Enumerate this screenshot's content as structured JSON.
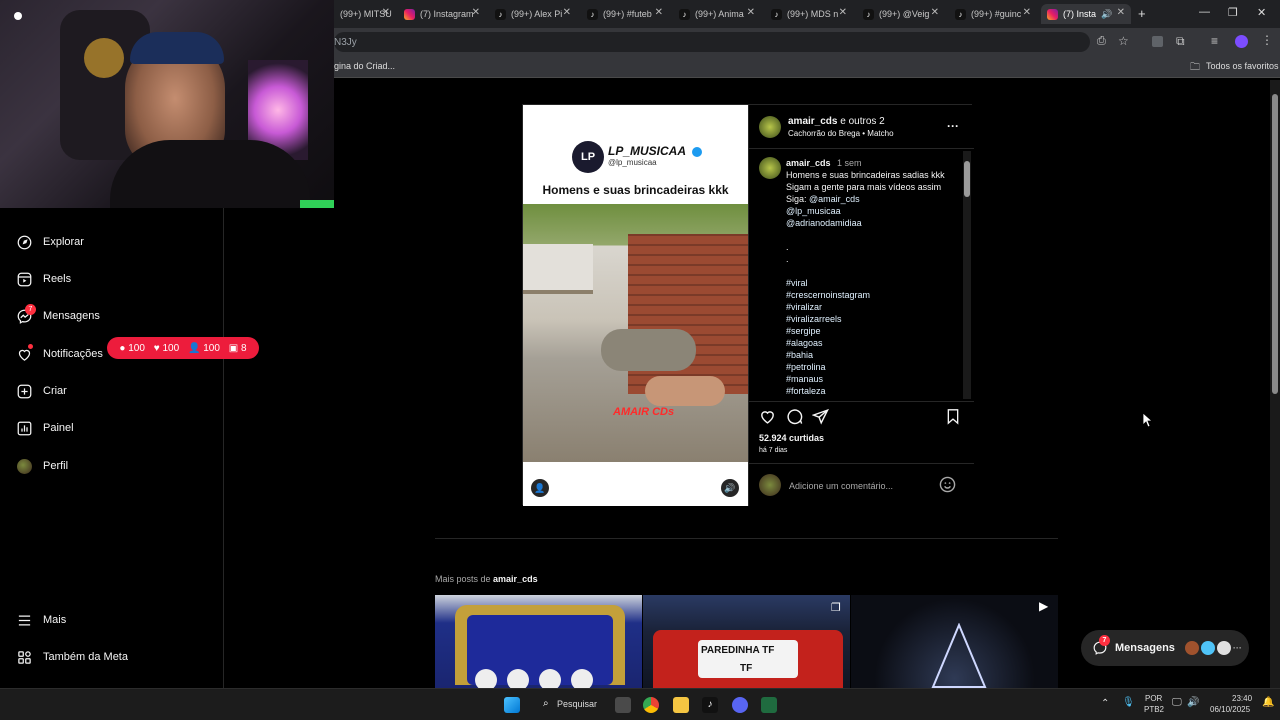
{
  "browser": {
    "tabs": [
      {
        "label": "(99+) MITSU"
      },
      {
        "label": "(7) Instagram"
      },
      {
        "label": "(99+) Alex Pi"
      },
      {
        "label": "(99+) #futeb"
      },
      {
        "label": "(99+) Anima"
      },
      {
        "label": "(99+) MDS n"
      },
      {
        "label": "(99+) @Veig"
      },
      {
        "label": "(99+) #guinc"
      },
      {
        "label": "(7) Insta"
      }
    ],
    "url_fragment": "N3Jy",
    "bookmark_item": "gina do Criad...",
    "all_bookmarks": "Todos os favoritos"
  },
  "sidebar": {
    "items": [
      {
        "label": "Explorar",
        "icon": "compass-icon"
      },
      {
        "label": "Reels",
        "icon": "reels-icon"
      },
      {
        "label": "Mensagens",
        "icon": "messenger-icon",
        "badge": "7"
      },
      {
        "label": "Notificações",
        "icon": "heart-icon"
      },
      {
        "label": "Criar",
        "icon": "plus-square-icon"
      },
      {
        "label": "Painel",
        "icon": "bar-chart-icon"
      },
      {
        "label": "Perfil",
        "icon": "avatar-icon"
      },
      {
        "label": "Mais",
        "icon": "menu-icon"
      },
      {
        "label": "Também da Meta",
        "icon": "meta-icon"
      }
    ],
    "notif_counts": {
      "comments": "100",
      "likes": "100",
      "follows": "100",
      "tags": "8"
    }
  },
  "post": {
    "author": "amair_cds",
    "coauthors": "e outros 2",
    "audio": "Cachorrão do Brega • Matcho",
    "media": {
      "brand": "LP_MUSICAA",
      "brand_handle": "@lp_musicaa",
      "headline": "Homens e suas brincadeiras kkk",
      "watermark": "AMAIR CDs"
    },
    "caption_author": "amair_cds",
    "caption_time": "1 sem",
    "caption_lines": [
      "Homens e suas brincadeiras sadias kkk",
      "Sigam a gente para mais vídeos assim"
    ],
    "siga_label": "Siga:",
    "mentions": [
      "@amair_cds",
      "@lp_musicaa",
      "@adrianodamidiaa"
    ],
    "dots": [
      ".",
      "."
    ],
    "hashtags": [
      "#viral",
      "#crescernoinstagram",
      "#viralizar",
      "#viralizarreels",
      "#sergipe",
      "#alagoas",
      "#bahia",
      "#petrolina",
      "#manaus",
      "#fortaleza"
    ],
    "likes": "52.924 curtidas",
    "date": "há 7 dias",
    "comment_placeholder": "Adicione um comentário..."
  },
  "more_posts": {
    "label_prefix": "Mais posts de",
    "user": "amair_cds",
    "thumb2_text": "PAREDINHA TF",
    "thumb2_sub": "TF"
  },
  "messages_pill": {
    "label": "Mensagens",
    "badge": "7"
  },
  "taskbar": {
    "search": "Pesquisar",
    "lang": "POR",
    "lang2": "PTB2",
    "time": "23:40",
    "date": "06/10/2025"
  }
}
